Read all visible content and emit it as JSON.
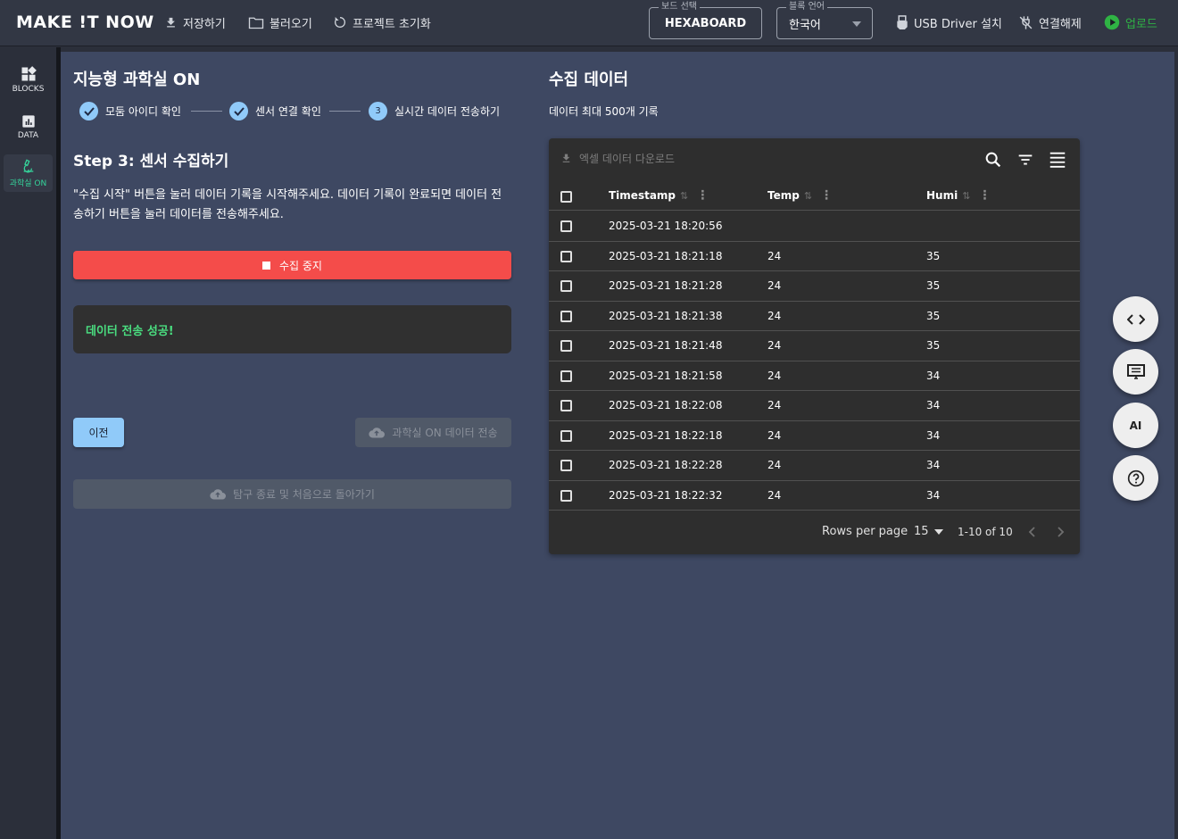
{
  "header": {
    "logo": "MAKE !T NOW",
    "save": "저장하기",
    "load": "불러오기",
    "reset": "프로젝트 초기화",
    "board_legend": "보드 선택",
    "board_value": "HEXABOARD",
    "lang_legend": "블록 언어",
    "lang_value": "한국어",
    "usb_driver": "USB Driver 설치",
    "disconnect": "연결해제",
    "upload": "업로드"
  },
  "sidebar": {
    "items": [
      {
        "label": "BLOCKS",
        "icon": "blocks-icon"
      },
      {
        "label": "DATA",
        "icon": "chart-icon"
      },
      {
        "label": "과학실 ON",
        "icon": "microscope-icon"
      }
    ]
  },
  "left": {
    "title": "지능형 과학실 ON",
    "steps": [
      {
        "label": "모둠 아이디 확인",
        "state": "done"
      },
      {
        "label": "센서 연결 확인",
        "state": "done"
      },
      {
        "label": "실시간 데이터 전송하기",
        "number": "3",
        "state": "active"
      }
    ],
    "step_title": "Step 3: 센서 수집하기",
    "description": "\"수집 시작\" 버튼을 눌러 데이터 기록을 시작해주세요. 데이터 기록이 완료되면 데이터 전송하기 버튼을 눌러 데이터를 전송해주세요.",
    "stop_button": "수집 중지",
    "alert_text": "데이터 전송 성공!",
    "prev_button": "이전",
    "send_button": "과학실 ON 데이터 전송",
    "end_button": "탐구 종료 및 처음으로 돌아가기"
  },
  "right": {
    "title": "수집 데이터",
    "subtitle": "데이터 최대 500개 기록",
    "download_label": "엑셀 데이터 다운로드",
    "columns": [
      "Timestamp",
      "Temp",
      "Humi"
    ],
    "rows": [
      [
        "2025-03-21 18:20:56",
        "",
        ""
      ],
      [
        "2025-03-21 18:21:18",
        "24",
        "35"
      ],
      [
        "2025-03-21 18:21:28",
        "24",
        "35"
      ],
      [
        "2025-03-21 18:21:38",
        "24",
        "35"
      ],
      [
        "2025-03-21 18:21:48",
        "24",
        "35"
      ],
      [
        "2025-03-21 18:21:58",
        "24",
        "34"
      ],
      [
        "2025-03-21 18:22:08",
        "24",
        "34"
      ],
      [
        "2025-03-21 18:22:18",
        "24",
        "34"
      ],
      [
        "2025-03-21 18:22:28",
        "24",
        "34"
      ],
      [
        "2025-03-21 18:22:32",
        "24",
        "34"
      ]
    ],
    "rows_per_page_label": "Rows per page",
    "rows_per_page_value": "15",
    "page_range": "1-10 of 10"
  },
  "fabs": {
    "code_icon": "code-icon",
    "monitor_icon": "serial-monitor-icon",
    "ai_label": "AI",
    "help_icon": "help-icon"
  },
  "colors": {
    "accent_blue": "#90caf9",
    "stop_red": "#f44c4a",
    "success_green": "#4ade80",
    "upload_green": "#2fb344",
    "panel_bg": "#3e4862"
  }
}
